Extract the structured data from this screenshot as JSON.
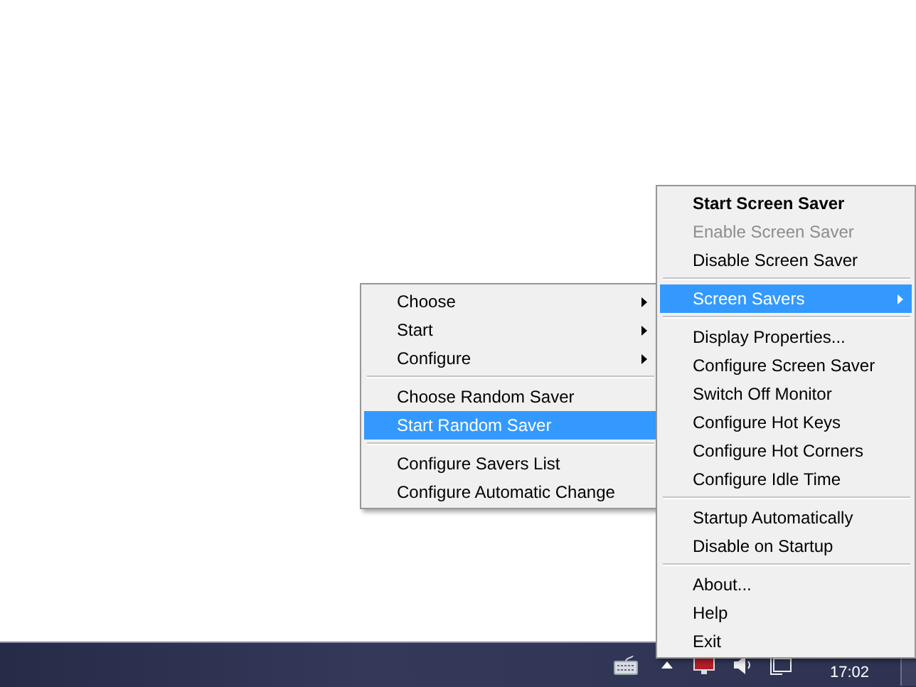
{
  "main_menu": {
    "items": [
      {
        "kind": "item",
        "label": "Start Screen Saver",
        "default": true,
        "disabled": false,
        "selected": false,
        "submenu": false
      },
      {
        "kind": "item",
        "label": "Enable Screen Saver",
        "default": false,
        "disabled": true,
        "selected": false,
        "submenu": false
      },
      {
        "kind": "item",
        "label": "Disable Screen Saver",
        "default": false,
        "disabled": false,
        "selected": false,
        "submenu": false
      },
      {
        "kind": "separator"
      },
      {
        "kind": "item",
        "label": "Screen Savers",
        "default": false,
        "disabled": false,
        "selected": true,
        "submenu": true
      },
      {
        "kind": "separator"
      },
      {
        "kind": "item",
        "label": "Display Properties...",
        "default": false,
        "disabled": false,
        "selected": false,
        "submenu": false
      },
      {
        "kind": "item",
        "label": "Configure Screen Saver",
        "default": false,
        "disabled": false,
        "selected": false,
        "submenu": false
      },
      {
        "kind": "item",
        "label": "Switch Off Monitor",
        "default": false,
        "disabled": false,
        "selected": false,
        "submenu": false
      },
      {
        "kind": "item",
        "label": "Configure Hot Keys",
        "default": false,
        "disabled": false,
        "selected": false,
        "submenu": false
      },
      {
        "kind": "item",
        "label": "Configure Hot Corners",
        "default": false,
        "disabled": false,
        "selected": false,
        "submenu": false
      },
      {
        "kind": "item",
        "label": "Configure Idle Time",
        "default": false,
        "disabled": false,
        "selected": false,
        "submenu": false
      },
      {
        "kind": "separator"
      },
      {
        "kind": "item",
        "label": "Startup Automatically",
        "default": false,
        "disabled": false,
        "selected": false,
        "submenu": false
      },
      {
        "kind": "item",
        "label": "Disable on Startup",
        "default": false,
        "disabled": false,
        "selected": false,
        "submenu": false
      },
      {
        "kind": "separator"
      },
      {
        "kind": "item",
        "label": "About...",
        "default": false,
        "disabled": false,
        "selected": false,
        "submenu": false
      },
      {
        "kind": "item",
        "label": "Help",
        "default": false,
        "disabled": false,
        "selected": false,
        "submenu": false
      },
      {
        "kind": "item",
        "label": "Exit",
        "default": false,
        "disabled": false,
        "selected": false,
        "submenu": false
      }
    ]
  },
  "submenu": {
    "items": [
      {
        "kind": "item",
        "label": "Choose",
        "default": false,
        "disabled": false,
        "selected": false,
        "submenu": true
      },
      {
        "kind": "item",
        "label": "Start",
        "default": false,
        "disabled": false,
        "selected": false,
        "submenu": true
      },
      {
        "kind": "item",
        "label": "Configure",
        "default": false,
        "disabled": false,
        "selected": false,
        "submenu": true
      },
      {
        "kind": "separator"
      },
      {
        "kind": "item",
        "label": "Choose Random Saver",
        "default": false,
        "disabled": false,
        "selected": false,
        "submenu": false
      },
      {
        "kind": "item",
        "label": "Start Random Saver",
        "default": false,
        "disabled": false,
        "selected": true,
        "submenu": false
      },
      {
        "kind": "separator"
      },
      {
        "kind": "item",
        "label": "Configure Savers List",
        "default": false,
        "disabled": false,
        "selected": false,
        "submenu": false
      },
      {
        "kind": "item",
        "label": "Configure Automatic Change",
        "default": false,
        "disabled": false,
        "selected": false,
        "submenu": false
      }
    ]
  },
  "taskbar": {
    "clock": "17:02"
  }
}
